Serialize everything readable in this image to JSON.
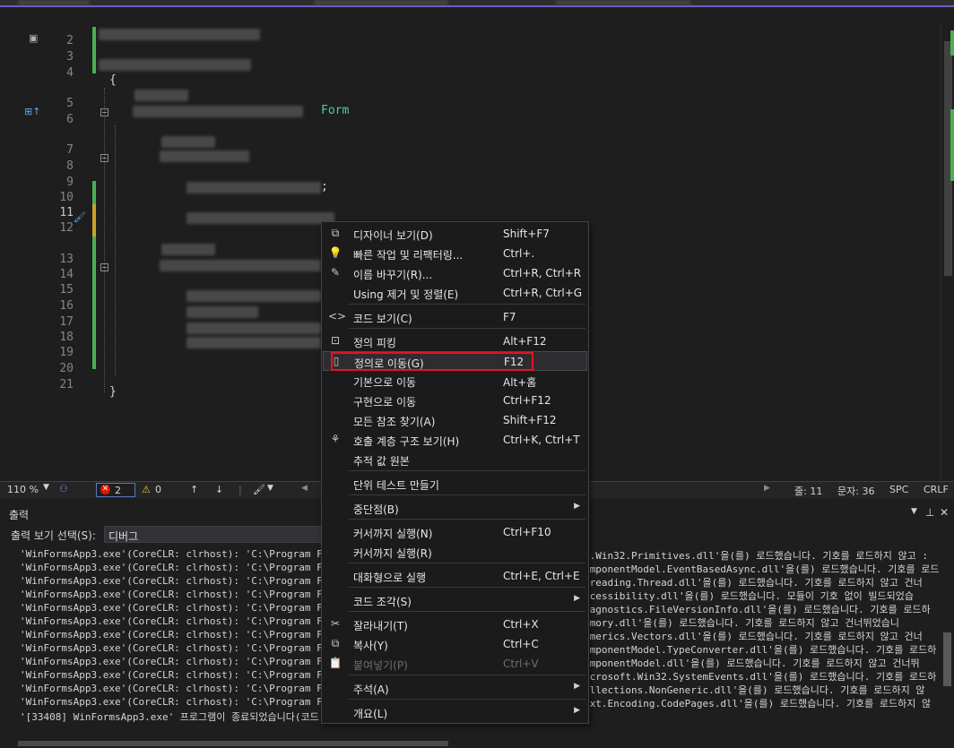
{
  "editor": {
    "form_token": "Form",
    "line_numbers": [
      "2",
      "3",
      "4",
      "5",
      "6",
      "7",
      "8",
      "9",
      "10",
      "11",
      "12",
      "13",
      "14",
      "15",
      "16",
      "17",
      "18",
      "19",
      "20",
      "21"
    ],
    "brace_open": "{",
    "brace_close": "}",
    "semicolon": ";"
  },
  "editor_status": {
    "zoom": "110 %",
    "errors": "2",
    "warnings": "0",
    "line": "줄: 11",
    "column": "문자: 36",
    "whitespace": "SPC",
    "line_ending": "CRLF"
  },
  "output": {
    "title": "출력",
    "source_label": "출력 보기 선택(S):",
    "source_value": "디버그",
    "lines_left": [
      "'WinFormsApp3.exe'(CoreCLR: clrhost): 'C:\\Program Files\\d",
      "'WinFormsApp3.exe'(CoreCLR: clrhost): 'C:\\Program Files\\d",
      "'WinFormsApp3.exe'(CoreCLR: clrhost): 'C:\\Program Files\\d",
      "'WinFormsApp3.exe'(CoreCLR: clrhost): 'C:\\Program Files\\d",
      "'WinFormsApp3.exe'(CoreCLR: clrhost): 'C:\\Program Files\\d",
      "'WinFormsApp3.exe'(CoreCLR: clrhost): 'C:\\Program Files\\d",
      "'WinFormsApp3.exe'(CoreCLR: clrhost): 'C:\\Program Files\\d",
      "'WinFormsApp3.exe'(CoreCLR: clrhost): 'C:\\Program Files\\d",
      "'WinFormsApp3.exe'(CoreCLR: clrhost): 'C:\\Program Files\\d",
      "'WinFormsApp3.exe'(CoreCLR: clrhost): 'C:\\Program Files\\d",
      "'WinFormsApp3.exe'(CoreCLR: clrhost): 'C:\\Program Files\\d",
      "'WinFormsApp3.exe'(CoreCLR: clrhost): 'C:\\Program Files\\d",
      "'[33408] WinFormsApp3.exe' 프로그램이 종료되었습니다(코드"
    ],
    "lines_right": [
      "t.Win32.Primitives.dll'을(를) 로드했습니다. 기호를 로드하지 않고 :",
      "omponentModel.EventBasedAsync.dll'을(를) 로드했습니다. 기호를 로드",
      "nreading.Thread.dll'을(를) 로드했습니다. 기호를 로드하지 않고 건너",
      "ccessibility.dll'을(를) 로드했습니다. 모듈이 기호 없이 빌드되었습",
      "iagnostics.FileVersionInfo.dll'을(를) 로드했습니다. 기호를 로드하",
      "emory.dll'을(를) 로드했습니다. 기호를 로드하지 않고 건너뛰었습니",
      "umerics.Vectors.dll'을(를) 로드했습니다. 기호를 로드하지 않고 건너",
      "omponentModel.TypeConverter.dll'을(를) 로드했습니다. 기호를 로드하",
      "omponentModel.dll'을(를) 로드했습니다. 기호를 로드하지 않고 건너뛰",
      "icrosoft.Win32.SystemEvents.dll'을(를) 로드했습니다. 기호를 로드하",
      "ollections.NonGeneric.dll'을(를) 로드했습니다. 기호를 로드하지 않",
      "ext.Encoding.CodePages.dll'을(를) 로드했습니다. 기호를 로드하지 않",
      ""
    ]
  },
  "context_menu": {
    "items": [
      {
        "icon": "designer-icon",
        "glyph": "⧉",
        "label": "디자이너 보기(D)",
        "shortcut": "Shift+F7"
      },
      {
        "icon": "lightbulb-icon",
        "glyph": "💡",
        "label": "빠른 작업 및 리팩터링...",
        "shortcut": "Ctrl+."
      },
      {
        "icon": "rename-icon",
        "glyph": "✎",
        "label": "이름 바꾸기(R)...",
        "shortcut": "Ctrl+R, Ctrl+R"
      },
      {
        "icon": "",
        "glyph": "",
        "label": "Using 제거 및 정렬(E)",
        "shortcut": "Ctrl+R, Ctrl+G"
      },
      {
        "icon": "code-icon",
        "glyph": "<>",
        "label": "코드 보기(C)",
        "shortcut": "F7"
      },
      {
        "icon": "peek-icon",
        "glyph": "⊡",
        "label": "정의 피킹",
        "shortcut": "Alt+F12"
      },
      {
        "icon": "goto-definition-icon",
        "glyph": "▯",
        "label": "정의로 이동(G)",
        "shortcut": "F12"
      },
      {
        "icon": "",
        "glyph": "",
        "label": "기본으로 이동",
        "shortcut": "Alt+홈"
      },
      {
        "icon": "",
        "glyph": "",
        "label": "구현으로 이동",
        "shortcut": "Ctrl+F12"
      },
      {
        "icon": "",
        "glyph": "",
        "label": "모든 참조 찾기(A)",
        "shortcut": "Shift+F12"
      },
      {
        "icon": "call-hierarchy-icon",
        "glyph": "⚘",
        "label": "호출 계층 구조 보기(H)",
        "shortcut": "Ctrl+K, Ctrl+T"
      },
      {
        "icon": "",
        "glyph": "",
        "label": "추적 값 원본",
        "shortcut": ""
      },
      {
        "icon": "",
        "glyph": "",
        "label": "단위 테스트 만들기",
        "shortcut": ""
      },
      {
        "icon": "",
        "glyph": "",
        "label": "중단점(B)",
        "shortcut": ""
      },
      {
        "icon": "",
        "glyph": "",
        "label": "커서까지 실행(N)",
        "shortcut": "Ctrl+F10"
      },
      {
        "icon": "",
        "glyph": "",
        "label": "커서까지 실행(R)",
        "shortcut": ""
      },
      {
        "icon": "",
        "glyph": "",
        "label": "대화형으로 실행",
        "shortcut": "Ctrl+E, Ctrl+E"
      },
      {
        "icon": "",
        "glyph": "",
        "label": "코드 조각(S)",
        "shortcut": ""
      },
      {
        "icon": "scissors-icon",
        "glyph": "✂",
        "label": "잘라내기(T)",
        "shortcut": "Ctrl+X"
      },
      {
        "icon": "copy-icon",
        "glyph": "⧉",
        "label": "복사(Y)",
        "shortcut": "Ctrl+C"
      },
      {
        "icon": "paste-icon",
        "glyph": "📋",
        "label": "붙여넣기(P)",
        "shortcut": "Ctrl+V"
      },
      {
        "icon": "",
        "glyph": "",
        "label": "주석(A)",
        "shortcut": ""
      },
      {
        "icon": "",
        "glyph": "",
        "label": "개요(L)",
        "shortcut": ""
      }
    ],
    "submenu_arrow": "▶"
  },
  "colors": {
    "accent_purple": "#6e5dc6",
    "change_green": "#4caf50",
    "highlight_red": "#e81123",
    "type_teal": "#4ec9b0"
  }
}
